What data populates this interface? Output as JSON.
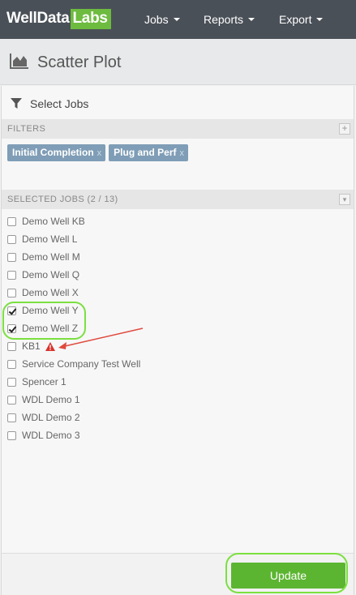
{
  "brand": {
    "part1": "WellData",
    "part2": "Labs"
  },
  "nav": {
    "jobs": "Jobs",
    "reports": "Reports",
    "export": "Export"
  },
  "page": {
    "title": "Scatter Plot"
  },
  "panel": {
    "select_jobs_label": "Select Jobs",
    "filters_label": "FILTERS",
    "filters_button": "+",
    "filters": [
      {
        "label": "Initial Completion",
        "remove": "x"
      },
      {
        "label": "Plug and Perf",
        "remove": "x"
      }
    ],
    "selected_label": "SELECTED JOBS (2 / 13)",
    "selected_button": "▾",
    "jobs": [
      {
        "name": "Demo Well KB",
        "checked": false,
        "warning": false
      },
      {
        "name": "Demo Well L",
        "checked": false,
        "warning": false
      },
      {
        "name": "Demo Well M",
        "checked": false,
        "warning": false
      },
      {
        "name": "Demo Well Q",
        "checked": false,
        "warning": false
      },
      {
        "name": "Demo Well X",
        "checked": false,
        "warning": false
      },
      {
        "name": "Demo Well Y",
        "checked": true,
        "warning": false
      },
      {
        "name": "Demo Well Z",
        "checked": true,
        "warning": false
      },
      {
        "name": "KB1",
        "checked": false,
        "warning": true
      },
      {
        "name": "Service Company Test Well",
        "checked": false,
        "warning": false
      },
      {
        "name": "Spencer 1",
        "checked": false,
        "warning": false
      },
      {
        "name": "WDL Demo 1",
        "checked": false,
        "warning": false
      },
      {
        "name": "WDL Demo 2",
        "checked": false,
        "warning": false
      },
      {
        "name": "WDL Demo 3",
        "checked": false,
        "warning": false
      }
    ],
    "update_label": "Update"
  },
  "colors": {
    "topbar": "#4a5058",
    "brand_accent": "#6dbb3f",
    "tag": "#7f9db6",
    "update_button": "#5cb531",
    "annotation_highlight": "#7be040",
    "annotation_arrow": "#e04a3f",
    "warning": "#d9312b"
  },
  "icons": {
    "page": "area-chart-icon",
    "select_jobs": "filter-icon",
    "warning": "warning-triangle-icon",
    "dropdown": "caret-down-icon"
  }
}
